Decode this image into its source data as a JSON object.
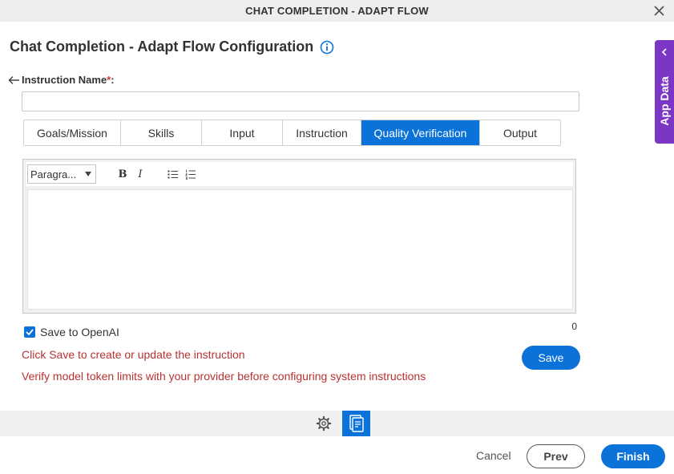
{
  "window": {
    "title": "CHAT COMPLETION - ADAPT FLOW"
  },
  "page": {
    "title": "Chat Completion - Adapt Flow Configuration"
  },
  "instruction_name": {
    "label": "Instruction Name",
    "required_mark": "*",
    "colon": ":",
    "value": "",
    "placeholder": ""
  },
  "tabs": [
    {
      "label": "Goals/Mission",
      "active": false
    },
    {
      "label": "Skills",
      "active": false
    },
    {
      "label": "Input",
      "active": false
    },
    {
      "label": "Instruction",
      "active": false
    },
    {
      "label": "Quality Verification",
      "active": true
    },
    {
      "label": "Output",
      "active": false
    }
  ],
  "editor": {
    "format_select": "Paragra...",
    "toolbar": [
      "bold-icon",
      "italic-icon",
      "bullet-list-icon",
      "numbered-list-icon"
    ],
    "bold_label": "B",
    "italic_label": "I",
    "content": "",
    "char_count": "0"
  },
  "save_to_openai": {
    "label": "Save to OpenAI",
    "checked": true
  },
  "messages": {
    "save_hint": "Click Save to create or update the instruction",
    "token_warning": "Verify model token limits with your provider before configuring system instructions"
  },
  "buttons": {
    "save": "Save",
    "cancel": "Cancel",
    "prev": "Prev",
    "finish": "Finish"
  },
  "side_panel": {
    "label": "App Data"
  },
  "bottom_toolbar": {
    "icons": [
      "gear-icon",
      "data-mapping-icon"
    ]
  },
  "colors": {
    "accent": "#0a72d8",
    "side_panel": "#7b36c6",
    "error_text": "#b83232"
  }
}
